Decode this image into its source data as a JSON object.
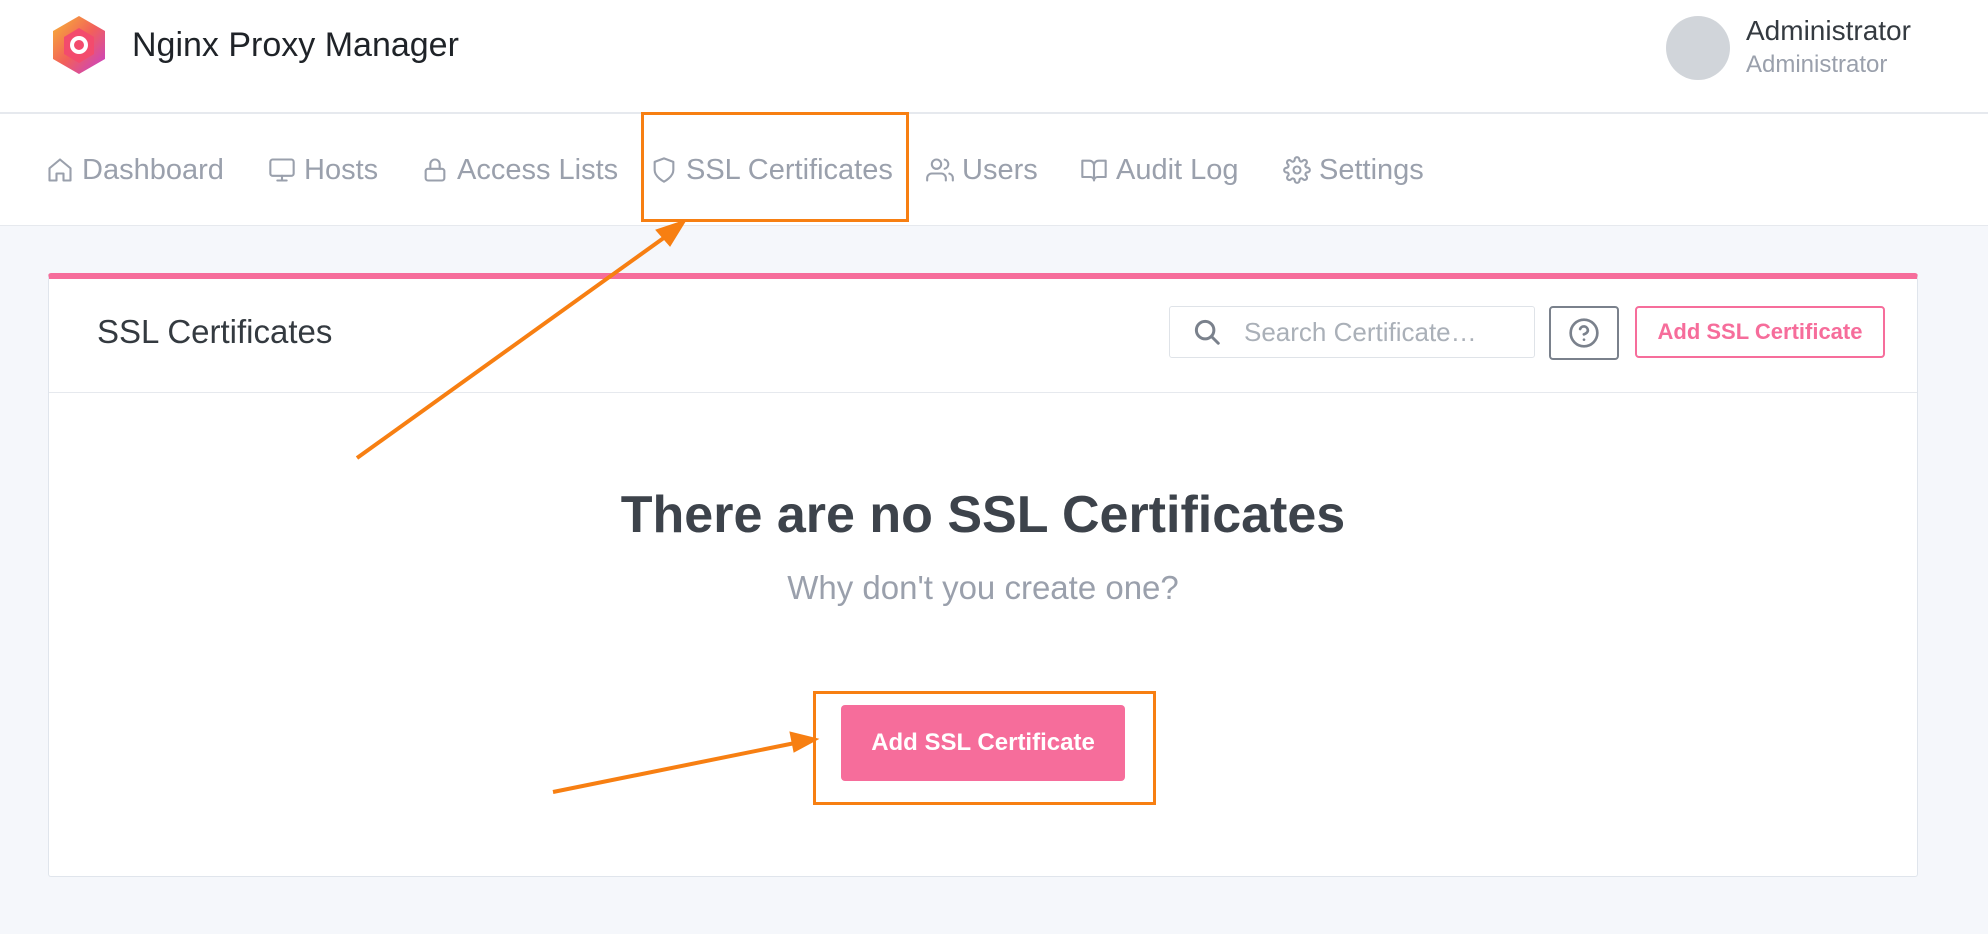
{
  "app": {
    "title": "Nginx Proxy Manager"
  },
  "user": {
    "name": "Administrator",
    "role": "Administrator"
  },
  "nav": {
    "items": [
      {
        "label": "Dashboard",
        "icon": "home-icon"
      },
      {
        "label": "Hosts",
        "icon": "monitor-icon"
      },
      {
        "label": "Access Lists",
        "icon": "lock-icon"
      },
      {
        "label": "SSL Certificates",
        "icon": "shield-icon"
      },
      {
        "label": "Users",
        "icon": "users-icon"
      },
      {
        "label": "Audit Log",
        "icon": "book-icon"
      },
      {
        "label": "Settings",
        "icon": "gear-icon"
      }
    ]
  },
  "card": {
    "title": "SSL Certificates",
    "search_placeholder": "Search Certificate…",
    "add_button": "Add SSL Certificate"
  },
  "empty": {
    "title": "There are no SSL Certificates",
    "subtitle": "Why don't you create one?",
    "button": "Add SSL Certificate"
  },
  "colors": {
    "accent": "#f66d9b",
    "annotation": "#f77f12"
  }
}
